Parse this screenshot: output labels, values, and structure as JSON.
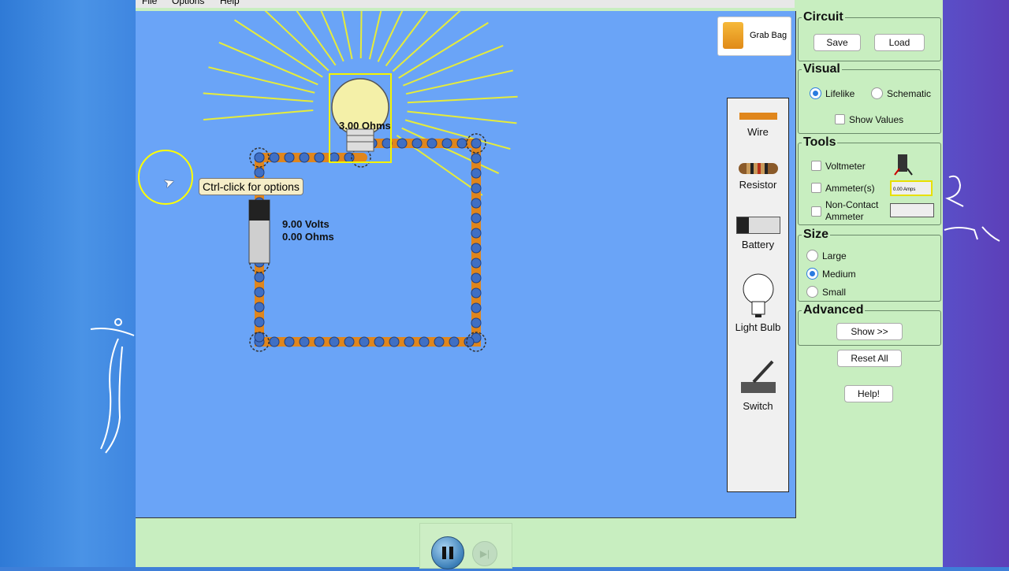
{
  "menu": {
    "file": "File",
    "options": "Options",
    "help": "Help"
  },
  "canvas": {
    "tooltip": "Ctrl-click for options",
    "bulb_resistance": "3.00 Ohms",
    "battery_voltage": "9.00 Volts",
    "battery_resistance": "0.00 Ohms",
    "grab_bag": "Grab Bag"
  },
  "toolbox": {
    "wire": "Wire",
    "resistor": "Resistor",
    "battery": "Battery",
    "light_bulb": "Light Bulb",
    "switch": "Switch"
  },
  "panel": {
    "circuit": {
      "title": "Circuit",
      "save": "Save",
      "load": "Load"
    },
    "visual": {
      "title": "Visual",
      "lifelike": "Lifelike",
      "schematic": "Schematic",
      "show_values": "Show Values",
      "selected": "Lifelike"
    },
    "tools": {
      "title": "Tools",
      "voltmeter": "Voltmeter",
      "ammeters": "Ammeter(s)",
      "noncontact_1": "Non-Contact",
      "noncontact_2": "Ammeter",
      "ammeter_readout": "0.00 Amps"
    },
    "size": {
      "title": "Size",
      "large": "Large",
      "medium": "Medium",
      "small": "Small",
      "selected": "Medium"
    },
    "advanced": {
      "title": "Advanced",
      "show": "Show >>"
    },
    "reset": "Reset All",
    "help": "Help!"
  },
  "colors": {
    "canvas_bg": "#6aa4f7",
    "panel_bg": "#c8eec0",
    "wire": "#e0861c",
    "electron": "#3f6fc4"
  }
}
